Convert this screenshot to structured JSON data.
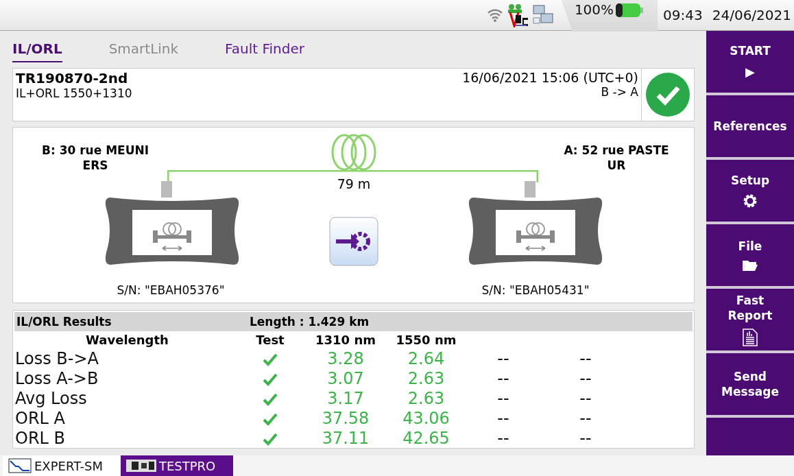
{
  "status_bar": {
    "battery_text": "100%",
    "time": "09:43",
    "date": "24/06/2021"
  },
  "tabs": [
    {
      "label": "IL/ORL",
      "selected": true,
      "disabled": false
    },
    {
      "label": "SmartLink",
      "selected": false,
      "disabled": true
    },
    {
      "label": "Fault Finder",
      "selected": false,
      "disabled": false
    }
  ],
  "header": {
    "title": "TR190870-2nd",
    "subtitle": "IL+ORL 1550+1310",
    "datetime": "16/06/2021 15:06 (UTC+0)",
    "direction": "B -> A",
    "passed": true
  },
  "diagram": {
    "end_b": {
      "address": "B: 30 rue MEUNI\nERS",
      "serial": "S/N: \"EBAH05376\""
    },
    "end_a": {
      "address": "A: 52 rue PASTE\nUR",
      "serial": "S/N: \"EBAH05431\""
    },
    "fiber_length": "79 m"
  },
  "results": {
    "title": "IL/ORL Results",
    "length": "Length : 1.429 km",
    "columns": [
      "Wavelength",
      "Test",
      "1310 nm",
      "1550 nm"
    ],
    "rows": [
      {
        "label": "Loss B->A",
        "passed": true,
        "values": [
          "3.28",
          "2.64",
          "--",
          "--"
        ]
      },
      {
        "label": "Loss A->B",
        "passed": true,
        "values": [
          "3.07",
          "2.63",
          "--",
          "--"
        ]
      },
      {
        "label": "Avg Loss",
        "passed": true,
        "values": [
          "3.17",
          "2.63",
          "--",
          "--"
        ]
      },
      {
        "label": "ORL A",
        "passed": true,
        "values": [
          "37.58",
          "43.06",
          "--",
          "--"
        ]
      },
      {
        "label": "ORL B",
        "passed": true,
        "values": [
          "37.11",
          "42.65",
          "--",
          "--"
        ]
      }
    ]
  },
  "sidebar": [
    {
      "label": "START",
      "kind": "glyph",
      "glyph": "▶"
    },
    {
      "label": "References",
      "kind": "text"
    },
    {
      "label": "Setup",
      "kind": "gear"
    },
    {
      "label": "File",
      "kind": "folder"
    },
    {
      "label": "Fast\nReport",
      "kind": "report"
    },
    {
      "label": "Send\nMessage",
      "kind": "text"
    }
  ],
  "taskbar": [
    {
      "label": "EXPERT-SM",
      "selected": false
    },
    {
      "label": "TESTPRO",
      "selected": true
    }
  ]
}
